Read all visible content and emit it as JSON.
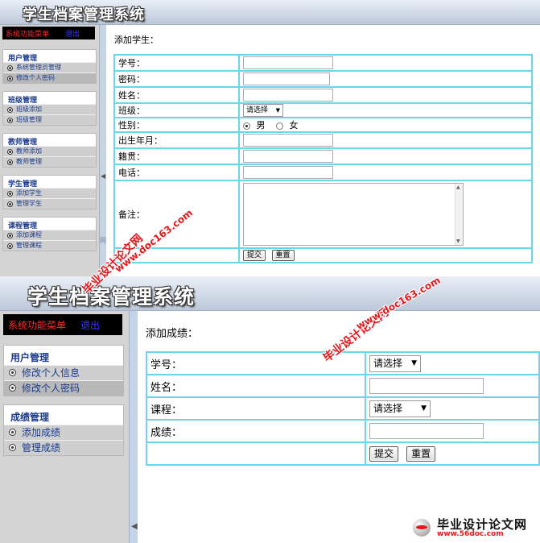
{
  "app_title": "学生档案管理系统",
  "menubar": {
    "system_menu": "系统功能菜单",
    "logout": "退出"
  },
  "panel1": {
    "page_title": "添加学生：",
    "groups": [
      {
        "title": "用户管理",
        "items": [
          {
            "label": "系统管理员管理"
          },
          {
            "label": "修改个人密码"
          }
        ]
      },
      {
        "title": "班级管理",
        "items": [
          {
            "label": "班级添加"
          },
          {
            "label": "班级管理"
          }
        ]
      },
      {
        "title": "教师管理",
        "items": [
          {
            "label": "教师添加"
          },
          {
            "label": "教师管理"
          }
        ]
      },
      {
        "title": "学生管理",
        "items": [
          {
            "label": "添加学生"
          },
          {
            "label": "管理学生"
          }
        ]
      },
      {
        "title": "课程管理",
        "items": [
          {
            "label": "添加课程"
          },
          {
            "label": "管理课程"
          }
        ]
      }
    ],
    "form": {
      "student_id_label": "学号：",
      "password_label": "密码：",
      "name_label": "姓名：",
      "class_label": "班级：",
      "class_select": "请选择",
      "gender_label": "性别：",
      "gender_male": "男",
      "gender_female": "女",
      "birth_label": "出生年月：",
      "native_label": "籍贯：",
      "phone_label": "电话：",
      "remark_label": "备注：",
      "submit": "提交",
      "reset": "重置"
    },
    "side_text": "网"
  },
  "panel2": {
    "page_title": "添加成绩：",
    "groups": [
      {
        "title": "用户管理",
        "items": [
          {
            "label": "修改个人信息"
          },
          {
            "label": "修改个人密码"
          }
        ]
      },
      {
        "title": "成绩管理",
        "items": [
          {
            "label": "添加成绩"
          },
          {
            "label": "管理成绩"
          }
        ]
      }
    ],
    "form": {
      "student_id_label": "学号：",
      "student_select": "请选择",
      "name_label": "姓名：",
      "course_label": "课程：",
      "course_select": "请选择",
      "score_label": "成绩：",
      "submit": "提交",
      "reset": "重置"
    }
  },
  "watermarks": {
    "cn": "毕业设计论文网",
    "url": "www.doc163.com"
  },
  "footer_logo": {
    "name": "毕业设计论文网",
    "url": "www.56doc.com"
  },
  "colors": {
    "accent_border": "#6bd6ea",
    "menu_red": "#ff2a2a",
    "menu_blue": "#3a3aff",
    "watermark_red": "#e8151b"
  }
}
